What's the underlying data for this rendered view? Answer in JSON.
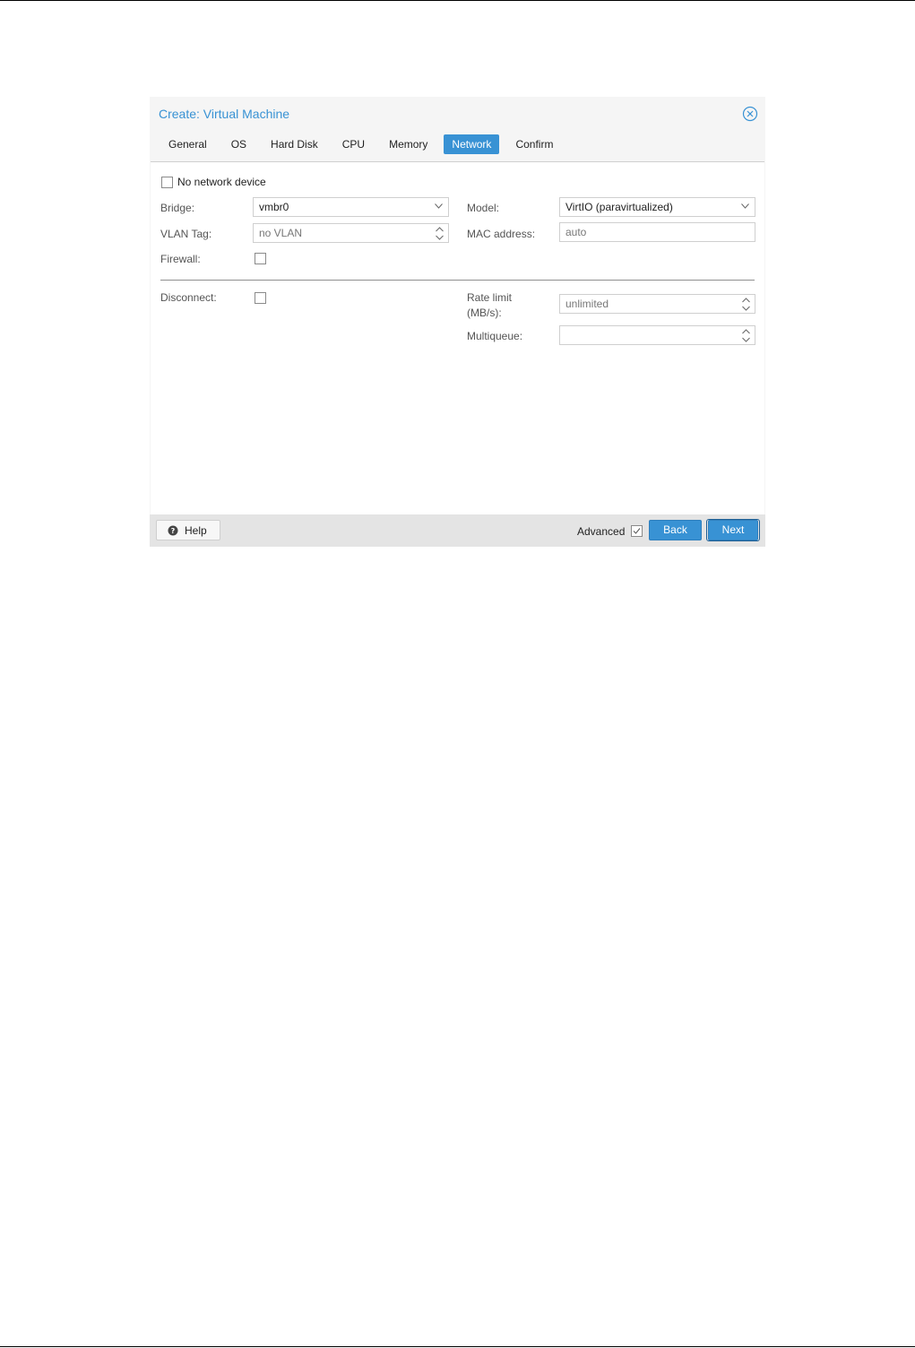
{
  "dialog": {
    "title": "Create: Virtual Machine",
    "tabs": [
      {
        "label": "General",
        "active": false
      },
      {
        "label": "OS",
        "active": false
      },
      {
        "label": "Hard Disk",
        "active": false
      },
      {
        "label": "CPU",
        "active": false
      },
      {
        "label": "Memory",
        "active": false
      },
      {
        "label": "Network",
        "active": true
      },
      {
        "label": "Confirm",
        "active": false
      }
    ]
  },
  "form": {
    "no_network_device": {
      "label": "No network device",
      "checked": false
    },
    "bridge": {
      "label": "Bridge:",
      "value": "vmbr0"
    },
    "vlan_tag": {
      "label": "VLAN Tag:",
      "placeholder": "no VLAN"
    },
    "firewall": {
      "label": "Firewall:",
      "checked": false
    },
    "model": {
      "label": "Model:",
      "value": "VirtIO (paravirtualized)"
    },
    "mac_address": {
      "label": "MAC address:",
      "placeholder": "auto"
    },
    "disconnect": {
      "label": "Disconnect:",
      "checked": false
    },
    "rate_limit": {
      "label_line1": "Rate limit",
      "label_line2": "(MB/s):",
      "placeholder": "unlimited"
    },
    "multiqueue": {
      "label": "Multiqueue:",
      "value": ""
    }
  },
  "footer": {
    "help_label": "Help",
    "advanced_label": "Advanced",
    "advanced_checked": true,
    "back_label": "Back",
    "next_label": "Next"
  },
  "colors": {
    "accent": "#3892d4",
    "footer_bg": "#e4e4e4",
    "dialog_bg": "#f5f5f5"
  },
  "icons": {
    "close": "close-icon",
    "help": "help-icon",
    "dropdown": "chevron-down-icon",
    "spinner": "spinner-icon"
  }
}
